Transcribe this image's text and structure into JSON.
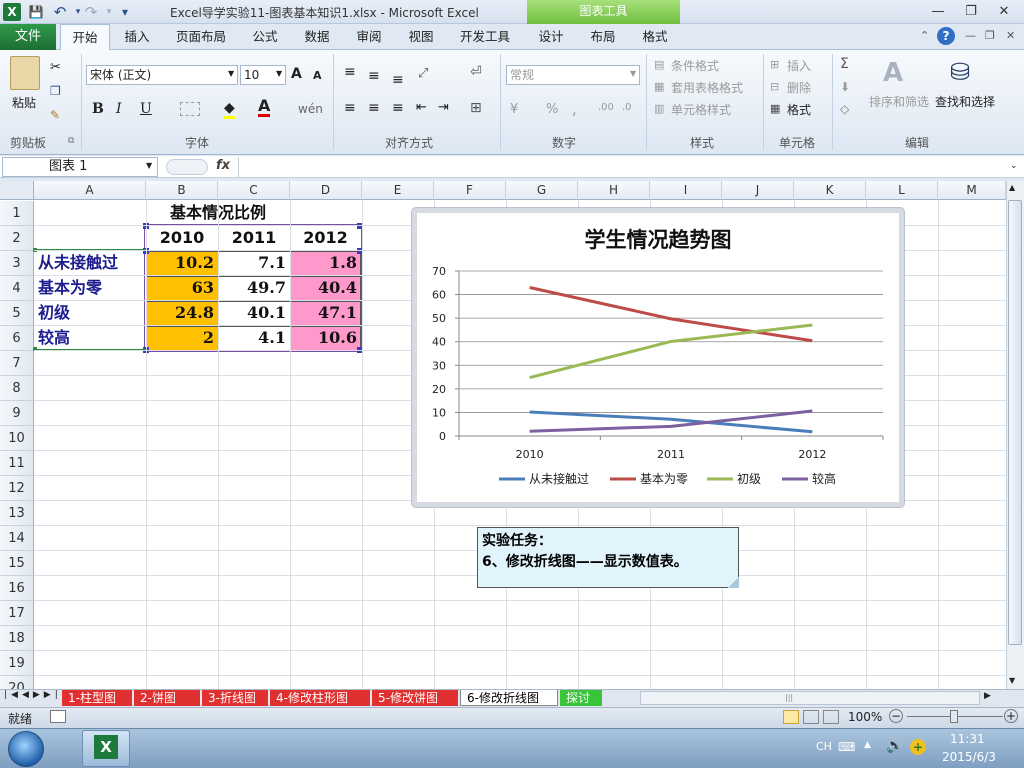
{
  "window": {
    "title": "Excel导学实验11-图表基本知识1.xlsx  -  Microsoft Excel",
    "app_icon": "X",
    "contextual_group": "图表工具",
    "controls": {
      "minimize": "—",
      "restore": "❐",
      "close": "✕"
    }
  },
  "quick_access": {
    "save": "💾",
    "undo": "↶",
    "redo": "↷",
    "customize": "▾"
  },
  "ribbon_tabs": [
    "文件",
    "开始",
    "插入",
    "页面布局",
    "公式",
    "数据",
    "审阅",
    "视图",
    "开发工具",
    "设计",
    "布局",
    "格式"
  ],
  "ribbon": {
    "clipboard": {
      "label": "剪贴板",
      "paste": "粘贴"
    },
    "font": {
      "label": "字体",
      "name": "宋体 (正文)",
      "size": "10",
      "bold": "B",
      "italic": "I",
      "underline": "U",
      "grow": "A",
      "shrink": "A",
      "wen": "wén"
    },
    "alignment": {
      "label": "对齐方式"
    },
    "number": {
      "label": "数字",
      "format": "常规",
      "percent": "%",
      "comma": ","
    },
    "styles": {
      "label": "样式",
      "conditional": "条件格式",
      "table": "套用表格格式",
      "cell_styles": "单元格样式"
    },
    "cells": {
      "label": "单元格",
      "insert": "插入",
      "delete": "删除",
      "format": "格式"
    },
    "editing": {
      "label": "编辑",
      "sigma": "Σ",
      "sort": "排序和筛选",
      "find": "查找和选择"
    }
  },
  "formula_bar": {
    "name_box": "图表 1",
    "fx": "fx",
    "formula": ""
  },
  "columns": [
    "A",
    "B",
    "C",
    "D",
    "E",
    "F",
    "G",
    "H",
    "I",
    "J",
    "K",
    "L",
    "M"
  ],
  "rows": [
    "1",
    "2",
    "3",
    "4",
    "5",
    "6",
    "7",
    "8",
    "9",
    "10",
    "11",
    "12",
    "13",
    "14",
    "15",
    "16",
    "17",
    "18",
    "19",
    "20"
  ],
  "table": {
    "title": "基本情况比例",
    "years": [
      "2010",
      "2011",
      "2012"
    ],
    "rows": [
      {
        "label": "从未接触过",
        "values": [
          "10.2",
          "7.1",
          "1.8"
        ]
      },
      {
        "label": "基本为零",
        "values": [
          "63",
          "49.7",
          "40.4"
        ]
      },
      {
        "label": "初级",
        "values": [
          "24.8",
          "40.1",
          "47.1"
        ]
      },
      {
        "label": "较高",
        "values": [
          "2",
          "4.1",
          "10.6"
        ]
      }
    ]
  },
  "chart_data": {
    "type": "line",
    "title": "学生情况趋势图",
    "categories": [
      "2010",
      "2011",
      "2012"
    ],
    "series": [
      {
        "name": "从未接触过",
        "values": [
          10.2,
          7.1,
          1.8
        ],
        "color": "#4a7ebb"
      },
      {
        "name": "基本为零",
        "values": [
          63,
          49.7,
          40.4
        ],
        "color": "#be4b48"
      },
      {
        "name": "初级",
        "values": [
          24.8,
          40.1,
          47.1
        ],
        "color": "#98b954"
      },
      {
        "name": "较高",
        "values": [
          2,
          4.1,
          10.6
        ],
        "color": "#7d60a0"
      }
    ],
    "ylim": [
      0,
      70
    ],
    "yticks": [
      "0",
      "10",
      "20",
      "30",
      "40",
      "50",
      "60",
      "70"
    ],
    "grid": true,
    "legend": "bottom"
  },
  "note": {
    "line1": "实验任务：",
    "line2": "6、修改折线图——显示数值表。"
  },
  "sheet_tabs": [
    {
      "label": "1-柱型图",
      "color": "#e03030"
    },
    {
      "label": "2-饼图",
      "color": "#e03030"
    },
    {
      "label": "3-折线图",
      "color": "#e03030"
    },
    {
      "label": "4-修改柱形图",
      "color": "#e03030"
    },
    {
      "label": "5-修改饼图",
      "color": "#e03030"
    },
    {
      "label": "6-修改折线图",
      "color": "#ffffff"
    },
    {
      "label": "探讨",
      "color": "#39c43a"
    }
  ],
  "status": {
    "ready": "就绪",
    "zoom": "100%"
  },
  "tray": {
    "lang": "CH",
    "time": "11:31",
    "date": "2015/6/3"
  },
  "colors": {
    "highlight_orange": "#ffc000",
    "highlight_pink": "#ff99cc",
    "excel_green": "#1e7a3c"
  }
}
